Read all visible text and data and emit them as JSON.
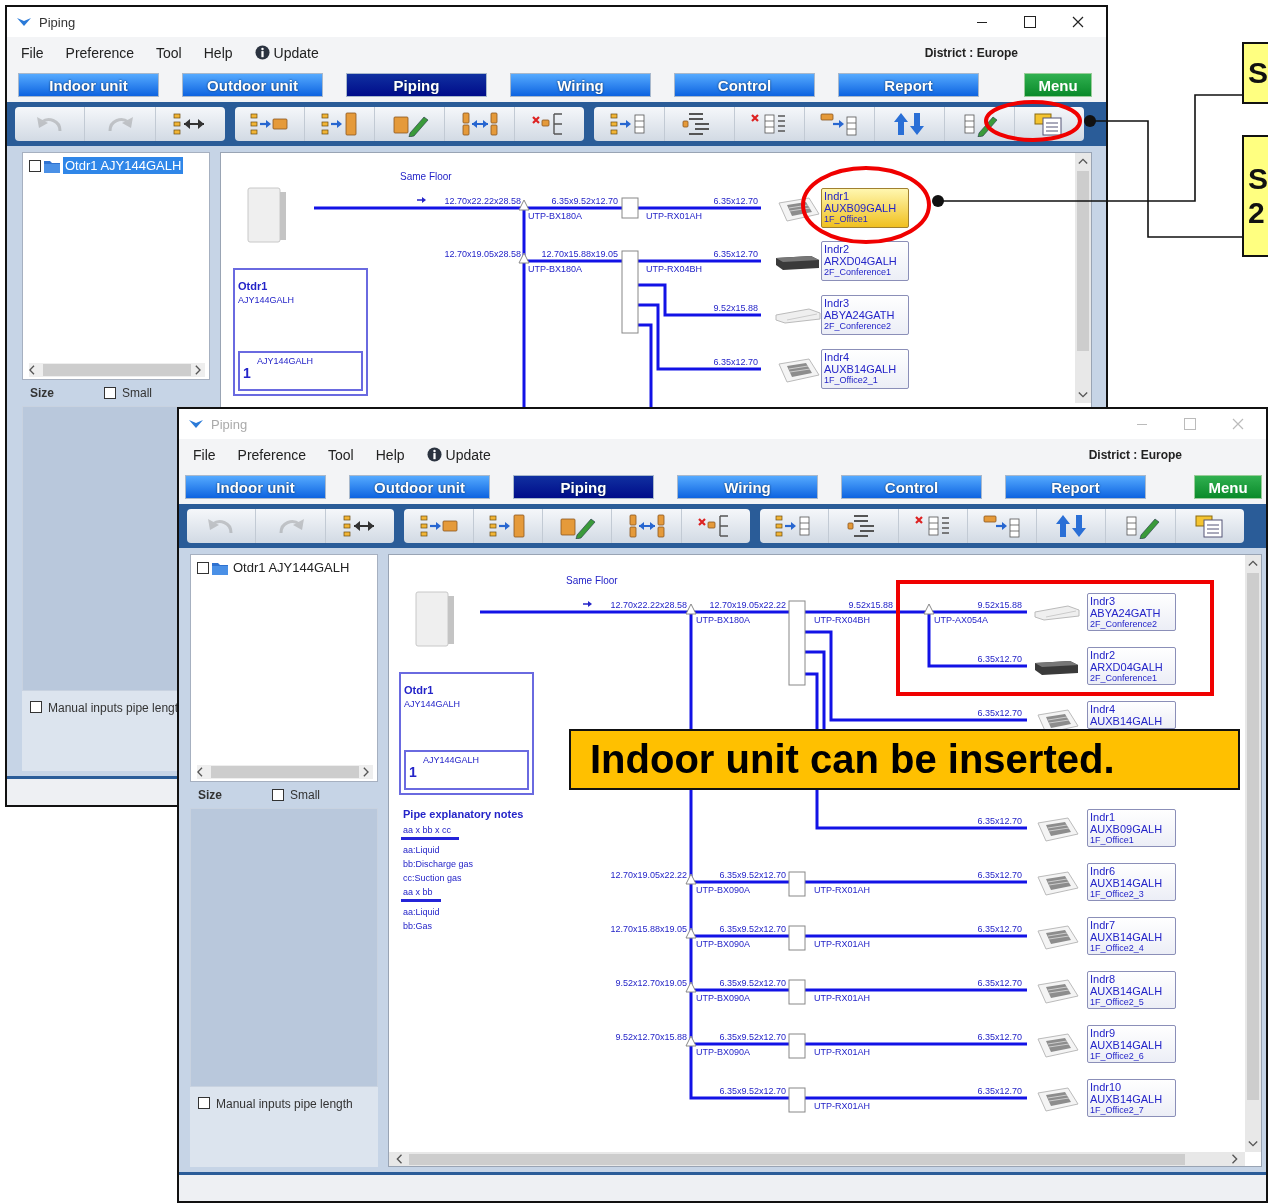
{
  "back_window": {
    "title": "Piping",
    "active": true,
    "menu": [
      {
        "label": "File"
      },
      {
        "label": "Preference"
      },
      {
        "label": "Tool"
      },
      {
        "label": "Help"
      },
      {
        "label": "Update"
      }
    ],
    "district": "District : Europe",
    "tabs": [
      {
        "label": "Indoor unit",
        "selected": false
      },
      {
        "label": "Outdoor unit",
        "selected": false
      },
      {
        "label": "Piping",
        "selected": true
      },
      {
        "label": "Wiring",
        "selected": false
      },
      {
        "label": "Control",
        "selected": false
      },
      {
        "label": "Report",
        "selected": false
      }
    ],
    "menu_button": "Menu",
    "toolbar_groups": [
      [
        {
          "disabled": true
        },
        {
          "disabled": true
        },
        {
          "disabled": false
        }
      ],
      [
        {
          "disabled": false
        },
        {
          "disabled": false
        },
        {
          "disabled": false
        },
        {
          "disabled": false
        },
        {
          "disabled": false
        }
      ],
      [
        {
          "disabled": false
        },
        {
          "disabled": false
        },
        {
          "disabled": false
        },
        {
          "disabled": false
        },
        {
          "disabled": false
        },
        {
          "disabled": false
        },
        {
          "disabled": false
        }
      ]
    ],
    "tree": [
      {
        "label": "Otdr1 AJY144GALH",
        "checked": false,
        "selected": true
      }
    ],
    "size_label": "Size",
    "small_option": {
      "label": "Small",
      "checked": false
    },
    "manual_lengths": {
      "label": "Manual inputs pipe lengt",
      "checked": false
    },
    "diagram": {
      "floor_label": "Same Floor",
      "outdoor_unit": {
        "name": "Otdr1",
        "model": "AJY144GALH",
        "inner_model": "AJY144GALH",
        "count": "1"
      },
      "pipe_sizes": [
        "12.70x22.22x28.58",
        "6.35x9.52x12.70",
        "6.35x12.70",
        "12.70x19.05x28.58",
        "12.70x15.88x19.05",
        "6.35x12.70",
        "9.52x15.88",
        "6.35x12.70"
      ],
      "fittings": [
        "UTP-BX180A",
        "UTP-RX01AH",
        "UTP-BX180A",
        "UTP-RX04BH"
      ],
      "indoor_units": [
        {
          "name": "Indr1",
          "model": "AUXB09GALH",
          "location": "1F_Office1",
          "kind": "cassette",
          "selected": true
        },
        {
          "name": "Indr2",
          "model": "ARXD04GALH",
          "location": "2F_Conference1",
          "kind": "duct",
          "selected": false
        },
        {
          "name": "Indr3",
          "model": "ABYA24GATH",
          "location": "2F_Conference2",
          "kind": "ceiling",
          "selected": false
        },
        {
          "name": "Indr4",
          "model": "AUXB14GALH",
          "location": "1F_Office2_1",
          "kind": "cassette",
          "selected": false
        }
      ]
    }
  },
  "front_window": {
    "title": "Piping",
    "active": false,
    "menu": [
      {
        "label": "File"
      },
      {
        "label": "Preference"
      },
      {
        "label": "Tool"
      },
      {
        "label": "Help"
      },
      {
        "label": "Update"
      }
    ],
    "district": "District : Europe",
    "tabs": [
      {
        "label": "Indoor unit",
        "selected": false
      },
      {
        "label": "Outdoor unit",
        "selected": false
      },
      {
        "label": "Piping",
        "selected": true
      },
      {
        "label": "Wiring",
        "selected": false
      },
      {
        "label": "Control",
        "selected": false
      },
      {
        "label": "Report",
        "selected": false
      }
    ],
    "menu_button": "Menu",
    "toolbar_groups": [
      [
        {
          "disabled": true
        },
        {
          "disabled": true
        },
        {
          "disabled": false
        }
      ],
      [
        {
          "disabled": false
        },
        {
          "disabled": false
        },
        {
          "disabled": false
        },
        {
          "disabled": false
        },
        {
          "disabled": false
        }
      ],
      [
        {
          "disabled": false
        },
        {
          "disabled": false
        },
        {
          "disabled": false
        },
        {
          "disabled": false
        },
        {
          "disabled": false
        },
        {
          "disabled": false
        },
        {
          "disabled": false
        }
      ]
    ],
    "tree": [
      {
        "label": "Otdr1 AJY144GALH",
        "checked": false,
        "selected": false
      }
    ],
    "size_label": "Size",
    "small_option": {
      "label": "Small",
      "checked": false
    },
    "manual_lengths": {
      "label": "Manual inputs pipe length",
      "checked": false
    },
    "diagram": {
      "floor_label": "Same Floor",
      "outdoor_unit": {
        "name": "Otdr1",
        "model": "AJY144GALH",
        "inner_model": "AJY144GALH",
        "count": "1"
      },
      "notes": {
        "title": "Pipe explanatory notes",
        "groups": [
          {
            "formula": "aa x bb x cc",
            "lines": [
              "aa:Liquid",
              "bb:Discharge gas",
              "cc:Suction gas"
            ]
          },
          {
            "formula": "aa x bb",
            "lines": [
              "aa:Liquid",
              "bb:Gas"
            ]
          }
        ]
      },
      "pipe_sizes": [
        "12.70x22.22x28.58",
        "12.70x19.05x22.22",
        "9.52x15.88",
        "9.52x15.88",
        "6.35x12.70",
        "6.35x12.70",
        "6.35x12.70",
        "12.70x19.05x22.22",
        "6.35x9.52x12.70",
        "6.35x12.70",
        "12.70x15.88x19.05",
        "6.35x9.52x12.70",
        "6.35x12.70",
        "9.52x12.70x19.05",
        "6.35x9.52x12.70",
        "6.35x12.70",
        "9.52x12.70x15.88",
        "6.35x9.52x12.70",
        "6.35x12.70",
        "6.35x9.52x12.70",
        "6.35x12.70"
      ],
      "fittings": [
        "UTP-BX180A",
        "UTP-RX04BH",
        "UTP-AX054A",
        "UTP-BX090A",
        "UTP-RX01AH",
        "UTP-BX090A",
        "UTP-RX01AH",
        "UTP-BX090A",
        "UTP-RX01AH",
        "UTP-BX090A",
        "UTP-RX01AH",
        "UTP-RX01AH"
      ],
      "indoor_units": [
        {
          "name": "Indr3",
          "model": "ABYA24GATH",
          "location": "2F_Conference2",
          "kind": "ceiling",
          "selected": false
        },
        {
          "name": "Indr2",
          "model": "ARXD04GALH",
          "location": "2F_Conference1",
          "kind": "duct",
          "selected": false
        },
        {
          "name": "Indr4",
          "model": "AUXB14GALH",
          "kind": "cassette",
          "selected": false
        },
        {
          "name": "Indr1",
          "model": "AUXB09GALH",
          "location": "1F_Office1",
          "kind": "cassette",
          "selected": false
        },
        {
          "name": "Indr6",
          "model": "AUXB14GALH",
          "location": "1F_Office2_3",
          "kind": "cassette",
          "selected": false
        },
        {
          "name": "Indr7",
          "model": "AUXB14GALH",
          "location": "1F_Office2_4",
          "kind": "cassette",
          "selected": false
        },
        {
          "name": "Indr8",
          "model": "AUXB14GALH",
          "location": "1F_Office2_5",
          "kind": "cassette",
          "selected": false
        },
        {
          "name": "Indr9",
          "model": "AUXB14GALH",
          "location": "1F_Office2_6",
          "kind": "cassette",
          "selected": false
        },
        {
          "name": "Indr10",
          "model": "AUXB14GALH",
          "location": "1F_Office2_7",
          "kind": "cassette",
          "selected": false
        }
      ]
    }
  },
  "annotations": {
    "callouts": [
      {
        "lines": [
          "S"
        ]
      },
      {
        "lines": [
          "S",
          "2"
        ]
      }
    ],
    "banner": "Indoor unit can be inserted."
  }
}
